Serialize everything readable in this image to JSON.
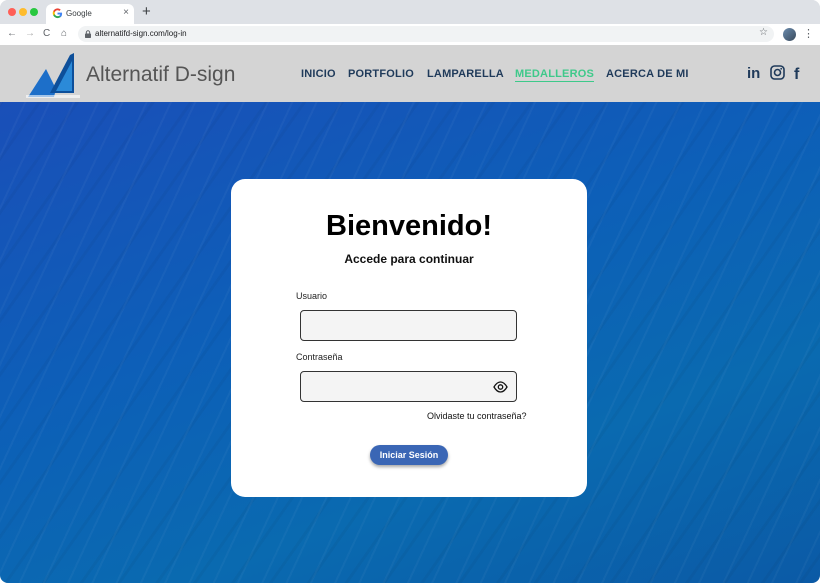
{
  "browser": {
    "tab_title": "Google",
    "tab_close": "×",
    "new_tab": "+",
    "url": "alternatifd-sign.com/log-in",
    "back": "←",
    "forward": "→",
    "reload": "C",
    "home": "⌂",
    "star": "☆",
    "menu": "⋮"
  },
  "site": {
    "logo_text": "Alternatif D-sign",
    "nav": [
      "INICIO",
      "PORTFOLIO",
      "LAMPARELLA",
      "MEDALLEROS",
      "ACERCA DE MI"
    ],
    "active_nav": "MEDALLEROS",
    "social_icons": [
      "linkedin-icon",
      "instagram-icon",
      "facebook-icon"
    ],
    "social_text": {
      "linkedin": "in",
      "facebook": "f"
    }
  },
  "login": {
    "title": "Bienvenido!",
    "subtitle": "Accede para continuar",
    "username_label": "Usuario",
    "username_value": "",
    "password_label": "Contraseña",
    "password_value": "",
    "forgot_link": "Olvidaste tu contraseña?",
    "submit_label": "Iniciar Sesión"
  },
  "colors": {
    "header_bg": "#d4d4d4",
    "nav_text": "#1f3a5a",
    "nav_active": "#3ec98a",
    "hero_blue": "#0d5fb8",
    "button_bg": "#3a66b5"
  }
}
